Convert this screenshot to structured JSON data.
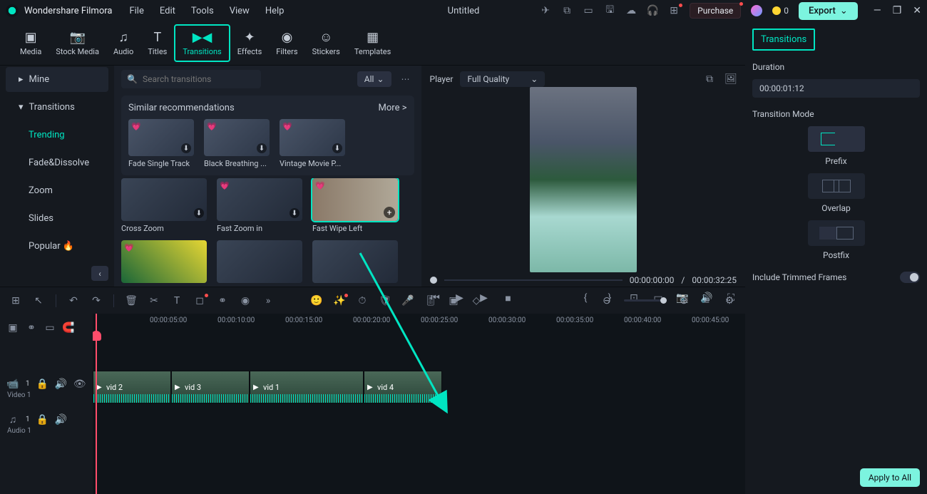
{
  "app": {
    "title": "Wondershare Filmora",
    "document": "Untitled"
  },
  "menu": [
    "File",
    "Edit",
    "Tools",
    "View",
    "Help"
  ],
  "titlebar": {
    "purchase": "Purchase",
    "credits": "0",
    "export": "Export"
  },
  "tabs": [
    {
      "id": "media",
      "label": "Media"
    },
    {
      "id": "stock",
      "label": "Stock Media"
    },
    {
      "id": "audio",
      "label": "Audio"
    },
    {
      "id": "titles",
      "label": "Titles"
    },
    {
      "id": "transitions",
      "label": "Transitions",
      "active": true
    },
    {
      "id": "effects",
      "label": "Effects"
    },
    {
      "id": "filters",
      "label": "Filters"
    },
    {
      "id": "stickers",
      "label": "Stickers"
    },
    {
      "id": "templates",
      "label": "Templates"
    }
  ],
  "sidebar": {
    "top": [
      {
        "label": "Mine",
        "expand": "right"
      },
      {
        "label": "Transitions",
        "expand": "down"
      }
    ],
    "cats": [
      "Trending",
      "Fade&Dissolve",
      "Zoom",
      "Slides",
      "Popular 🔥"
    ],
    "selected": "Trending"
  },
  "search": {
    "placeholder": "Search transitions",
    "filter": "All"
  },
  "recommendations": {
    "title": "Similar recommendations",
    "more": "More >",
    "items": [
      {
        "label": "Fade Single Track"
      },
      {
        "label": "Black Breathing ..."
      },
      {
        "label": "Vintage Movie P..."
      }
    ]
  },
  "grid": [
    [
      {
        "label": "Cross Zoom"
      },
      {
        "label": "Fast Zoom in"
      },
      {
        "label": "Fast Wipe Left",
        "selected": true
      }
    ],
    [
      {
        "label": ""
      },
      {
        "label": ""
      },
      {
        "label": ""
      }
    ]
  ],
  "player": {
    "label": "Player",
    "quality": "Full Quality",
    "current": "00:00:00:00",
    "total": "00:00:32:25"
  },
  "inspector": {
    "tab": "Transitions",
    "durationLabel": "Duration",
    "duration": "00:00:01:12",
    "modeLabel": "Transition Mode",
    "modes": [
      "Prefix",
      "Overlap",
      "Postfix"
    ],
    "include": "Include Trimmed Frames",
    "apply": "Apply to All"
  },
  "ruler": [
    "00:00:05:00",
    "00:00:10:00",
    "00:00:15:00",
    "00:00:20:00",
    "00:00:25:00",
    "00:00:30:00",
    "00:00:35:00",
    "00:00:40:00",
    "00:00:45:00"
  ],
  "tracks": {
    "video": "Video 1",
    "audio": "Audio 1"
  },
  "clips": [
    {
      "label": "vid 2",
      "w": 110
    },
    {
      "label": "vid 3",
      "w": 110
    },
    {
      "label": "vid 1",
      "w": 160
    },
    {
      "label": "vid 4",
      "w": 110
    }
  ]
}
